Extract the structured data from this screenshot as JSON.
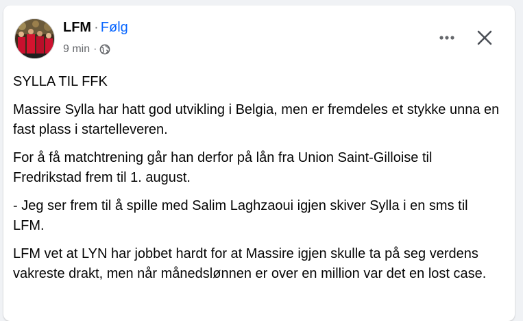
{
  "post": {
    "author": "LFM",
    "separator": "·",
    "follow_label": "Følg",
    "time": "9 min",
    "meta_separator": "·",
    "audience_icon": "globe-icon",
    "paragraphs": [
      "SYLLA TIL FFK",
      "Massire Sylla har hatt god utvikling i Belgia, men er fremdeles et stykke unna en fast plass i startelleveren.",
      "For å få matchtrening går han derfor på lån fra Union Saint-Gilloise til Fredrikstad frem til 1. august.",
      "- Jeg ser frem til å spille med Salim Laghzaoui igjen skiver Sylla i en sms til LFM.",
      "LFM vet at LYN har jobbet hardt for at Massire igjen skulle ta på seg verdens vakreste drakt, men når månedslønnen er over en million var det en lost case."
    ]
  },
  "actions": {
    "more_icon": "more-icon",
    "close_icon": "close-icon"
  },
  "colors": {
    "background": "#f0f2f5",
    "card": "#ffffff",
    "text": "#050505",
    "secondary": "#65676b",
    "link": "#0866ff"
  }
}
